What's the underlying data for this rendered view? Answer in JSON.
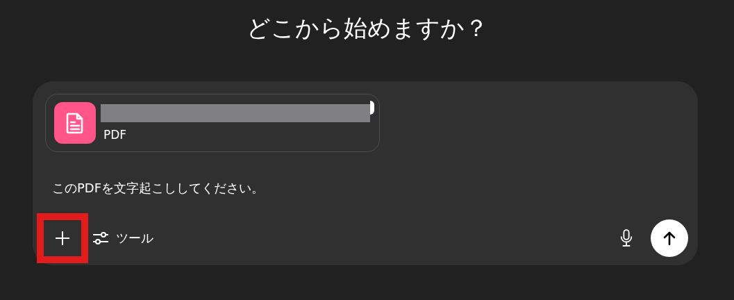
{
  "heading": "どこから始めますか？",
  "composer": {
    "attachment": {
      "file_type": "PDF"
    },
    "prompt": "このPDFを文字起こししてください。",
    "tools_label": "ツール"
  }
}
